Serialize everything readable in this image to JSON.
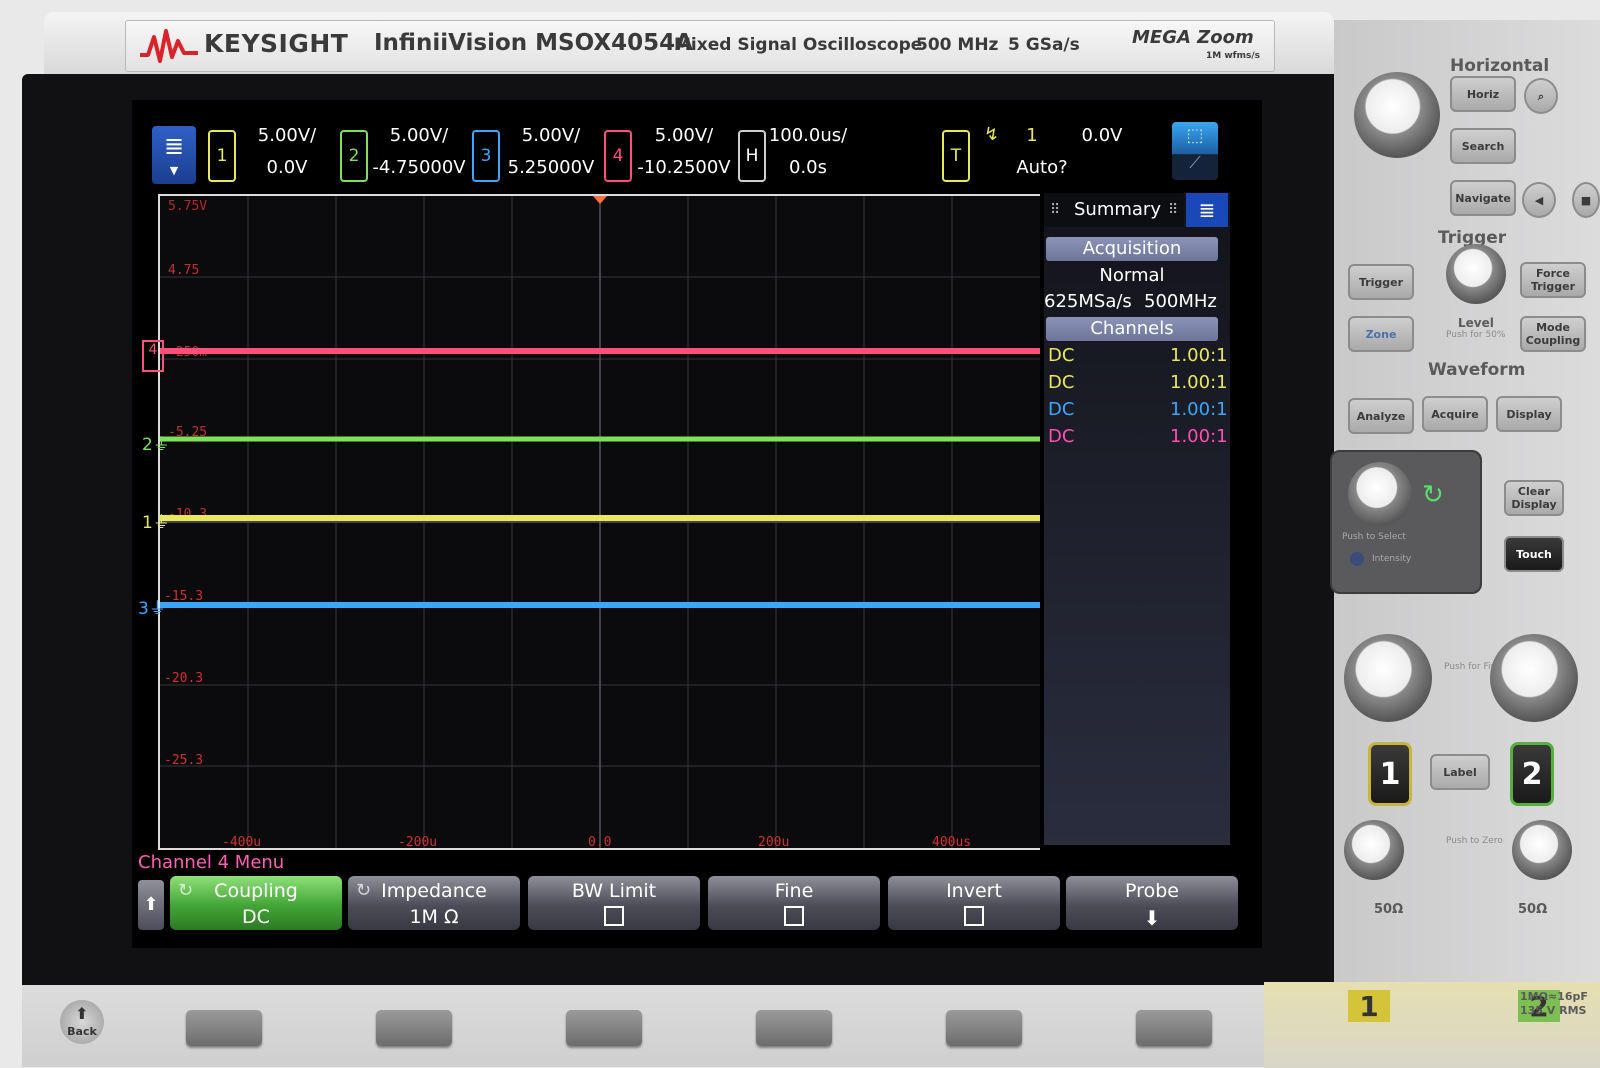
{
  "brand": {
    "company": "KEYSIGHT",
    "model": "InfiniiVision MSOX4054A",
    "description": "Mixed Signal Oscilloscope",
    "bandwidth": "500 MHz",
    "sample_rate": "5 GSa/s",
    "megazoom": "MEGA Zoom",
    "megazoom_sub": "1M wfms/s"
  },
  "status": {
    "channels": [
      {
        "num": "1",
        "scale": "5.00V/",
        "offset": "0.0V",
        "color": "#e8e85a"
      },
      {
        "num": "2",
        "scale": "5.00V/",
        "offset": "-4.75000V",
        "color": "#7fe05a"
      },
      {
        "num": "3",
        "scale": "5.00V/",
        "offset": "5.25000V",
        "color": "#3aa7ff"
      },
      {
        "num": "4",
        "scale": "5.00V/",
        "offset": "-10.2500V",
        "color": "#ff4f7a"
      }
    ],
    "horizontal": {
      "label": "H",
      "timebase": "100.0us/",
      "delay": "0.0s"
    },
    "trigger": {
      "label": "T",
      "source": "1",
      "level": "0.0V",
      "mode": "Auto?"
    }
  },
  "graticule": {
    "y_labels": [
      "5.75V",
      "4.75",
      "-250m",
      "-5.25",
      "-10.3",
      "-15.3",
      "-20.3",
      "-25.3"
    ],
    "x_labels": [
      "-400u",
      "-200u",
      "0.0",
      "200u",
      "400us"
    ],
    "label_color": "#e03030"
  },
  "traces": [
    {
      "channel": "4",
      "marker": "4",
      "color": "#ff4f7a"
    },
    {
      "channel": "2",
      "marker": "2",
      "color": "#7fe05a"
    },
    {
      "channel": "1",
      "marker": "1",
      "color": "#e8e85a"
    },
    {
      "channel": "3",
      "marker": "3",
      "color": "#3aa7ff"
    }
  ],
  "summary": {
    "tab": "Summary",
    "acquisition_head": "Acquisition",
    "mode": "Normal",
    "rate": "625MSa/s",
    "bw": "500MHz",
    "channels_head": "Channels",
    "rows": [
      {
        "coupling": "DC",
        "probe": "1.00:1",
        "color": "#e8e85a"
      },
      {
        "coupling": "DC",
        "probe": "1.00:1",
        "color": "#e8e85a"
      },
      {
        "coupling": "DC",
        "probe": "1.00:1",
        "color": "#3aa7ff"
      },
      {
        "coupling": "DC",
        "probe": "1.00:1",
        "color": "#ff4fb0"
      }
    ]
  },
  "menu": {
    "title": "Channel 4 Menu",
    "softkeys": [
      {
        "label": "Coupling",
        "value": "DC"
      },
      {
        "label": "Impedance",
        "value": "1M Ω"
      },
      {
        "label": "BW Limit"
      },
      {
        "label": "Fine"
      },
      {
        "label": "Invert"
      },
      {
        "label": "Probe"
      }
    ]
  },
  "panel": {
    "horizontal": "Horizontal",
    "horiz_btn": "Horiz",
    "search_btn": "Search",
    "navigate_btn": "Navigate",
    "trigger": "Trigger",
    "trigger_btn": "Trigger",
    "force_trigger_btn": "Force Trigger",
    "zone_btn": "Zone",
    "level_label": "Level",
    "level_sub": "Push for 50%",
    "mode_coupling_btn": "Mode Coupling",
    "waveform": "Waveform",
    "analyze_btn": "Analyze",
    "acquire_btn": "Acquire",
    "display_btn": "Display",
    "clear_display_btn": "Clear Display",
    "touch_btn": "Touch",
    "push_select": "Push to Select",
    "intensity": "Intensity",
    "ch1": "1",
    "ch2": "2",
    "label_btn": "Label",
    "push_fine": "Push for Fine",
    "push_zero": "Push to Zero",
    "ohm1": "50Ω",
    "ohm2": "50Ω",
    "spec": "1MΩ≈16pF",
    "spec2": "135 V RMS",
    "back": "Back"
  }
}
